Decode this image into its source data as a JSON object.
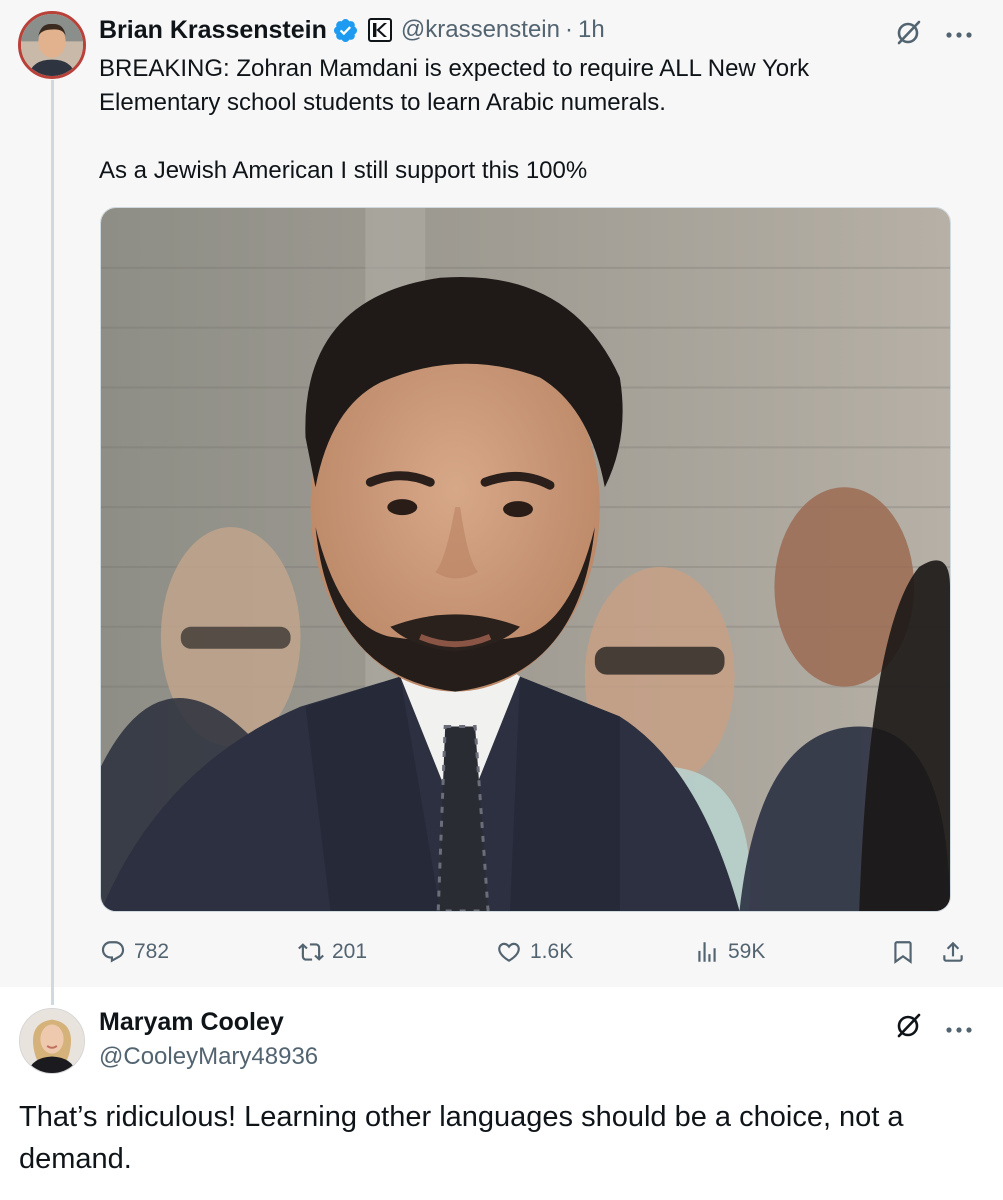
{
  "tweet": {
    "author": {
      "display_name": "Brian Krassenstein",
      "verified_icon": "verified-badge-icon",
      "affiliate_icon": "k-logo-icon",
      "handle": "@krassenstein",
      "separator": "·",
      "time": "1h"
    },
    "text_lines": [
      "BREAKING: Zohran Mamdani is expected to require ALL New York Elementary school students to learn Arabic numerals.",
      "As a Jewish American I still support this 100%"
    ],
    "media_icon": "photo-man-in-suit",
    "actions": {
      "replies": "782",
      "retweets": "201",
      "likes": "1.6K",
      "views": "59K"
    },
    "icons": {
      "grok": "grok-icon",
      "more": "more-icon",
      "reply": "reply-icon",
      "retweet": "retweet-icon",
      "like": "heart-icon",
      "views": "views-icon",
      "bookmark": "bookmark-icon",
      "share": "share-icon"
    }
  },
  "reply": {
    "display_name": "Maryam Cooley",
    "handle": "@CooleyMary48936",
    "text": "That’s ridiculous! Learning other languages should be a choice, not a demand."
  },
  "colors": {
    "text": "#0f1419",
    "secondary": "#536471",
    "verified": "#1d9bf0",
    "thread_line": "#cfd9de",
    "top_background": "#f7f7f7"
  }
}
